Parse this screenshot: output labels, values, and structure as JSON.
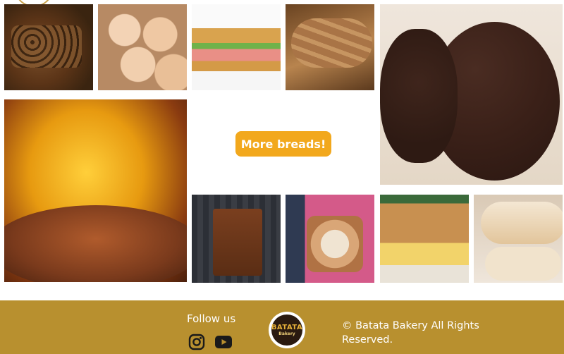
{
  "gallery": {
    "cta_label": "More breads!",
    "tiles": [
      {
        "name": "fruit-bread"
      },
      {
        "name": "cheese-buns"
      },
      {
        "name": "sandwich"
      },
      {
        "name": "baguette"
      },
      {
        "name": "chocolate-cookies"
      },
      {
        "name": "honey-bread"
      },
      {
        "name": "loaf-slices"
      },
      {
        "name": "pullman-bread"
      },
      {
        "name": "raisin-cake"
      },
      {
        "name": "white-bread"
      }
    ]
  },
  "footer": {
    "follow_label": "Follow us",
    "logo_text_main": "BATATA",
    "logo_text_sub": "Bakery",
    "copyright": "© Batata Bakery All Rights Reserved.",
    "social_icons": [
      "instagram-icon",
      "youtube-icon"
    ],
    "background_color": "#b8902f",
    "accent_color": "#f2a81d"
  }
}
